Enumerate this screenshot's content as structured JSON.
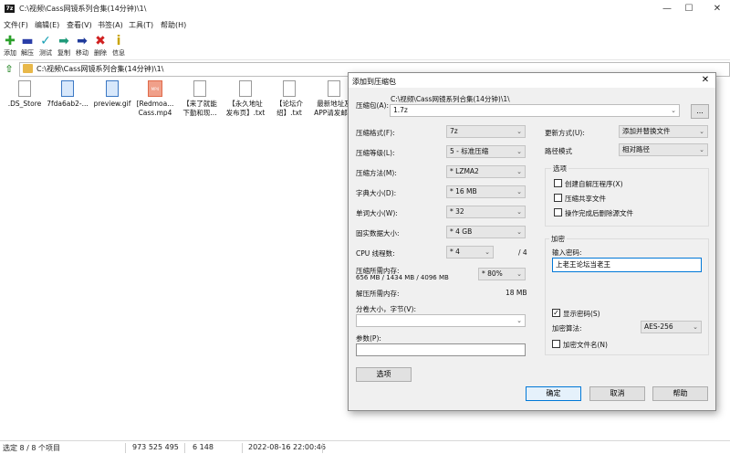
{
  "window": {
    "app_icon": "7z",
    "title": "C:\\视频\\Cass网镜系列合集(14分钟)\\1\\",
    "minimize": "—",
    "maximize": "☐",
    "close": "✕"
  },
  "menu": [
    "文件(F)",
    "编辑(E)",
    "查看(V)",
    "书签(A)",
    "工具(T)",
    "帮助(H)"
  ],
  "toolbar": [
    {
      "label": "添加",
      "icon": "add-icon",
      "glyph": "✚",
      "color": "#2aa02a"
    },
    {
      "label": "解压",
      "icon": "extract-icon",
      "glyph": "▬",
      "color": "#2a3ea8"
    },
    {
      "label": "测试",
      "icon": "test-icon",
      "glyph": "✓",
      "color": "#19a0b4"
    },
    {
      "label": "复制",
      "icon": "copy-icon",
      "glyph": "➡",
      "color": "#1f9a7a"
    },
    {
      "label": "移动",
      "icon": "move-icon",
      "glyph": "➡",
      "color": "#1f3a9a"
    },
    {
      "label": "删除",
      "icon": "delete-icon",
      "glyph": "✖",
      "color": "#d02020"
    },
    {
      "label": "信息",
      "icon": "info-icon",
      "glyph": "i",
      "color": "#c9a400"
    }
  ],
  "address": "C:\\视频\\Cass网镜系列合集(14分钟)\\1\\",
  "files": [
    {
      "name": ".DS_Store",
      "name2": "",
      "type": "doc"
    },
    {
      "name": "7fda6ab2-...",
      "name2": "",
      "type": "img"
    },
    {
      "name": "preview.gif",
      "name2": "",
      "type": "img"
    },
    {
      "name": "[Redmoa...",
      "name2": "Cass.mp4",
      "type": "mp4",
      "badge": "MP4"
    },
    {
      "name": "【来了就能",
      "name2": "下勤和现...",
      "type": "doc"
    },
    {
      "name": "【永久地址",
      "name2": "发布页】.txt",
      "type": "doc"
    },
    {
      "name": "【论坛介",
      "name2": "绍】.txt",
      "type": "doc"
    },
    {
      "name": "最新地址及",
      "name2": "APP请发邮...",
      "type": "doc"
    }
  ],
  "status": {
    "selected": "选定 8 / 8 个项目",
    "size": "973 525 495",
    "packed": "6 148",
    "date": "2022-08-16 22:00:46"
  },
  "dialog": {
    "title": "添加到压缩包",
    "close": "✕",
    "archive_label": "压缩包(A):",
    "archive_path": "C:\\视频\\Cass网镜系列合集(14分钟)\\1\\",
    "archive_name": "1.7z",
    "browse": "...",
    "format_label": "压缩格式(F):",
    "format": "7z",
    "level_label": "压缩等级(L):",
    "level": "5 - 标准压缩",
    "method_label": "压缩方法(M):",
    "method": "* LZMA2",
    "dict_label": "字典大小(D):",
    "dict": "* 16 MB",
    "word_label": "单词大小(W):",
    "word": "* 32",
    "solid_label": "固实数据大小:",
    "solid": "* 4 GB",
    "cpu_label": "CPU 线程数:",
    "cpu": "* 4",
    "cpu_total": "/ 4",
    "mem_label": "压缩所需内存:",
    "mem_value": "656 MB / 1434 MB / 4096 MB",
    "mem_pct": "* 80%",
    "dmem_label": "解压所需内存:",
    "dmem_value": "18 MB",
    "split_label": "分卷大小，字节(V):",
    "split_value": "",
    "params_label": "参数(P):",
    "params_value": "",
    "options_btn": "选项",
    "update_label": "更新方式(U):",
    "update": "添加并替换文件",
    "path_label": "路径模式",
    "path": "相对路径",
    "options_group": "选项",
    "opt_sfx": "创建自解压程序(X)",
    "opt_shared": "压缩共享文件",
    "opt_delete": "操作完成后删除源文件",
    "enc_group": "加密",
    "pwd_label": "输入密码:",
    "pwd_value": "上老王论坛当老王",
    "show_pwd": "显示密码(S)",
    "enc_method_label": "加密算法:",
    "enc_method": "AES-256",
    "enc_names": "加密文件名(N)",
    "ok": "确定",
    "cancel": "取消",
    "help": "帮助"
  }
}
